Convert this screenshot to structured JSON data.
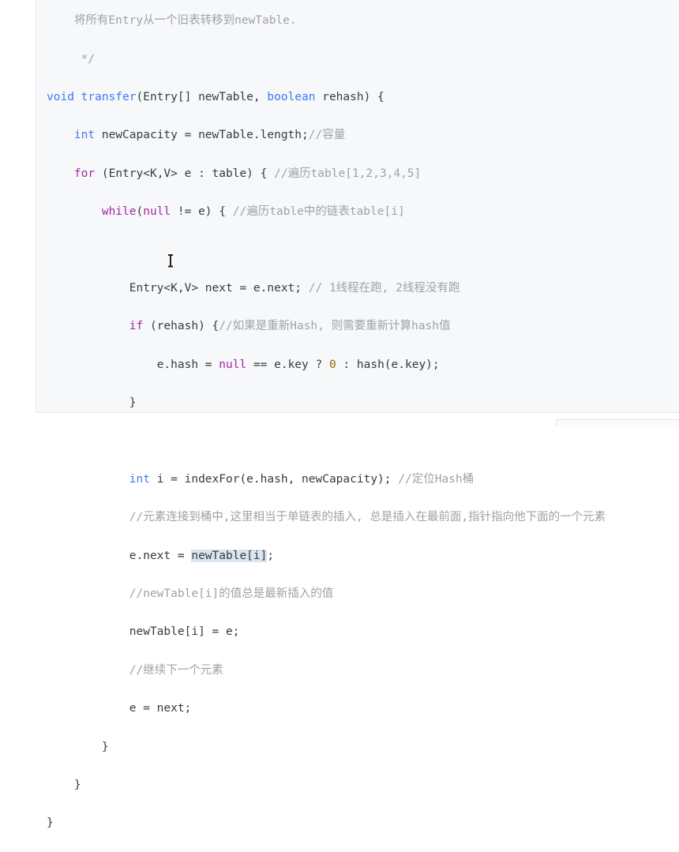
{
  "code": {
    "line0_comment": "    将所有Entry从一个旧表转移到newTable.",
    "line1_comment": "     */",
    "line2": {
      "kw_void": "void",
      "fn": "transfer",
      "open": "(Entry[] newTable, ",
      "kw_boolean": "boolean",
      "close": " rehash) {"
    },
    "line3": {
      "kw_int": "int",
      "code": " newCapacity = newTable.length;",
      "comment": "//容量"
    },
    "line4": {
      "kw_for": "for",
      "code": " (Entry<K,V> e : table) { ",
      "comment": "//遍历table[1,2,3,4,5]"
    },
    "line5": {
      "kw_while": "while",
      "open": "(",
      "kw_null": "null",
      "code": " != e) { ",
      "comment": "//遍历table中的链表table[i]"
    },
    "line7": {
      "code": "Entry<K,V> next = e.next; ",
      "comment": "// 1线程在跑, 2线程没有跑"
    },
    "line8": {
      "kw_if": "if",
      "code": " (rehash) {",
      "comment": "//如果是重新Hash, 则需要重新计算hash值"
    },
    "line9": {
      "pre": "e.hash = ",
      "kw_null": "null",
      "mid": " == e.key ? ",
      "num0": "0",
      "post": " : hash(e.key);"
    },
    "line10": "}",
    "line12": {
      "kw_int": "int",
      "code": " i = indexFor(e.hash, newCapacity); ",
      "comment": "//定位Hash桶"
    },
    "line13_comment": "//元素连接到桶中,这里相当于单链表的插入, 总是插入在最前面,指针指向他下面的一个元素",
    "line14": {
      "pre": "e.next = ",
      "highlight": "newTable[i]",
      "post": ";"
    },
    "line15_comment": "//newTable[i]的值总是最新插入的值",
    "line16": "newTable[i] = e;",
    "line17_comment": "//继续下一个元素",
    "line18": "e = next;",
    "line19": "}",
    "line20": "}",
    "line21": "}"
  },
  "colors": {
    "keyword": "#a626a4",
    "type_function": "#4078f2",
    "number": "#986801",
    "comment": "#a0a1a7",
    "text": "#383a42",
    "panel_bg": "#f6f8fa",
    "selection": "#dbe4f1"
  }
}
